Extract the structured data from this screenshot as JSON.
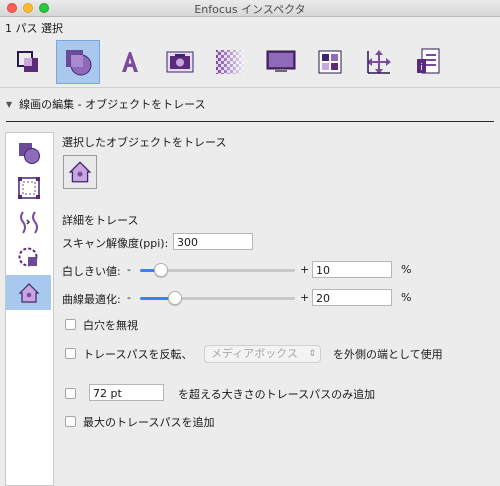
{
  "window": {
    "title": "Enfocus インスペクタ"
  },
  "selection_count": "1 パス 選択",
  "toolbar": {
    "items": [
      {
        "icon": "path-icon"
      },
      {
        "icon": "shapes-icon"
      },
      {
        "icon": "text-icon"
      },
      {
        "icon": "camera-icon"
      },
      {
        "icon": "transparency-icon"
      },
      {
        "icon": "monitor-icon"
      },
      {
        "icon": "color-grid-icon"
      },
      {
        "icon": "move-icon"
      },
      {
        "icon": "document-info-icon"
      }
    ],
    "active_index": 1
  },
  "section": {
    "title": "線画の編集 - オブジェクトをトレース"
  },
  "vertical_tabs": {
    "active_index": 4
  },
  "panel": {
    "heading": "選択したオブジェクトをトレース",
    "detail_heading": "詳細をトレース",
    "scan_resolution": {
      "label": "スキャン解像度(ppi):",
      "value": "300"
    },
    "whiteness": {
      "label": "白しきい値:",
      "minus": "-",
      "plus": "+",
      "value": "10",
      "unit": "%",
      "level": 0.1
    },
    "curve": {
      "label": "曲線最適化:",
      "minus": "-",
      "plus": "+",
      "value": "20",
      "unit": "%",
      "level": 0.2
    },
    "ignore_white": {
      "label": "白穴を無視"
    },
    "reverse": {
      "label": "トレースパスを反転、",
      "dropdown": "メディアボックス",
      "suffix": "を外側の端として使用"
    },
    "min_size": {
      "value": "72 pt",
      "label": "を超える大きさのトレースパスのみ追加"
    },
    "add_max": {
      "label": "最大のトレースパスを追加"
    }
  }
}
